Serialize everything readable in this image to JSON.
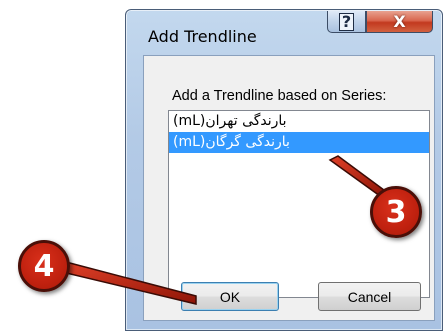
{
  "dialog": {
    "title": "Add Trendline",
    "help_glyph": "?",
    "close_glyph": "X",
    "prompt": "Add a Trendline based on Series:",
    "series": [
      {
        "label": "بارندگی تهران(mL)",
        "selected": false
      },
      {
        "label": "بارندگی گرگان(mL)",
        "selected": true
      }
    ],
    "ok_label": "OK",
    "cancel_label": "Cancel"
  },
  "annotations": {
    "step_list": "3",
    "step_ok": "4",
    "badge_color": "#c0210f"
  },
  "colors": {
    "selection": "#3399ff",
    "close_button": "#c2391f"
  }
}
